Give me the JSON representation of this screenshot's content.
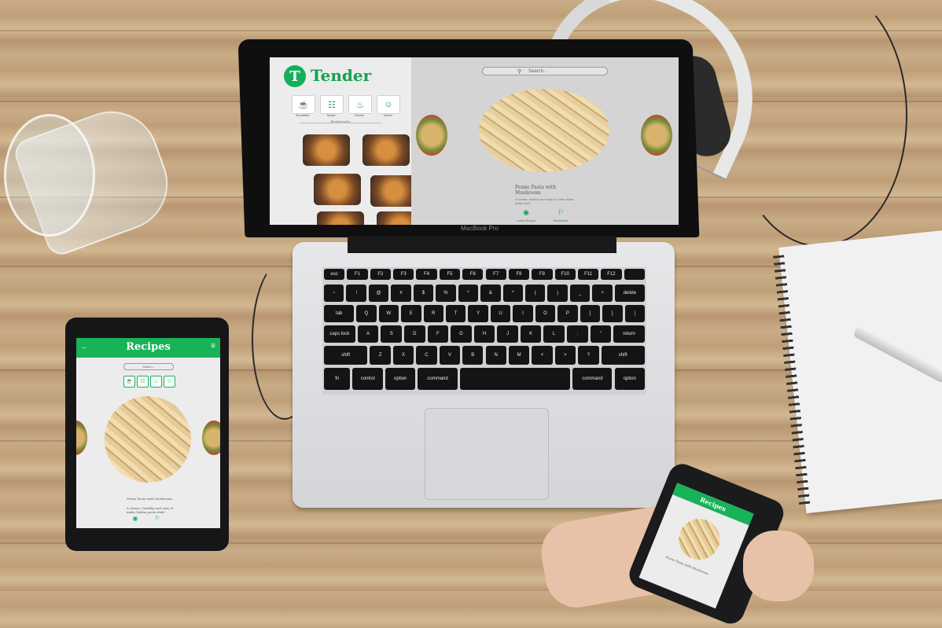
{
  "laptop": {
    "brand_label": "MacBook Pro",
    "app": {
      "logo_letter": "T",
      "title": "Tender",
      "categories": [
        {
          "label": "Breakfast",
          "icon": "breakfast-icon"
        },
        {
          "label": "Snack",
          "icon": "snack-icon"
        },
        {
          "label": "Dinner",
          "icon": "dinner-icon"
        },
        {
          "label": "Sweet",
          "icon": "sweet-icon"
        }
      ],
      "bookmarks_header": "Bookmarks",
      "search_placeholder": "Search...",
      "dish_title": "Penne Pasta with Mushroom",
      "dish_description": "A classic, healthy and easy to make Italian pasta dish!",
      "actions": [
        {
          "label": "Learn Recipe",
          "icon": "eye-icon"
        },
        {
          "label": "Bookmark",
          "icon": "bookmark-icon"
        }
      ]
    },
    "keyboard_rows": [
      [
        "esc",
        "F1",
        "F2",
        "F3",
        "F4",
        "F5",
        "F6",
        "F7",
        "F8",
        "F9",
        "F10",
        "F11",
        "F12",
        ""
      ],
      [
        "~",
        "!",
        "@",
        "#",
        "$",
        "%",
        "^",
        "&",
        "*",
        "(",
        ")",
        "_",
        "+",
        "delete"
      ],
      [
        "tab",
        "Q",
        "W",
        "E",
        "R",
        "T",
        "Y",
        "U",
        "I",
        "O",
        "P",
        "{",
        "}",
        "|"
      ],
      [
        "caps lock",
        "A",
        "S",
        "D",
        "F",
        "G",
        "H",
        "J",
        "K",
        "L",
        ":",
        "\"",
        "return"
      ],
      [
        "shift",
        "Z",
        "X",
        "C",
        "V",
        "B",
        "N",
        "M",
        "<",
        ">",
        "?",
        "shift"
      ],
      [
        "fn",
        "control",
        "option",
        "command",
        "",
        "command",
        "option"
      ]
    ]
  },
  "tablet": {
    "title": "Recipes",
    "search_placeholder": "Search...",
    "dish_title": "Penne Pasta with Mushroom",
    "dish_description": "A classic, healthy and easy to make Italian pasta dish!"
  },
  "phone": {
    "title": "Recipes",
    "dish_title": "Penne Pasta with Mushroom"
  },
  "colors": {
    "brand_green": "#13a152",
    "wood": "#c4a67f"
  }
}
